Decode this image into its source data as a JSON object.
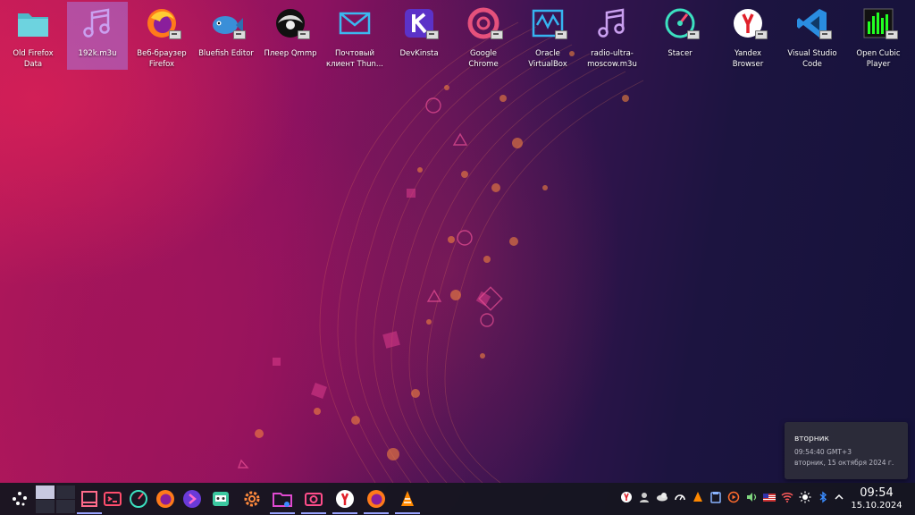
{
  "desktop": {
    "icons": [
      {
        "label": "Old Firefox\nData",
        "icon": "folder-icon"
      },
      {
        "label": "192k.m3u",
        "icon": "music-file-icon",
        "selected": true
      },
      {
        "label": "Веб-браузер\nFirefox",
        "icon": "firefox-icon"
      },
      {
        "label": "Bluefish Editor",
        "icon": "bluefish-icon"
      },
      {
        "label": "Плеер Qmmp",
        "icon": "qmmp-icon"
      },
      {
        "label": "Почтовый\nклиент Thun...",
        "icon": "mail-icon"
      },
      {
        "label": "DevKinsta",
        "icon": "devkinsta-icon"
      },
      {
        "label": "Google Chrome",
        "icon": "chrome-icon"
      },
      {
        "label": "Oracle\nVirtualBox",
        "icon": "virtualbox-icon"
      },
      {
        "label": "radio-ultra-\nmoscow.m3u",
        "icon": "music-file-icon"
      },
      {
        "label": "Stacer",
        "icon": "stacer-icon"
      },
      {
        "label": "Yandex Browser",
        "icon": "yandex-icon"
      },
      {
        "label": "Visual Studio\nCode",
        "icon": "vscode-icon"
      },
      {
        "label": "Open Cubic\nPlayer",
        "icon": "cubic-player-icon"
      }
    ]
  },
  "clock_popup": {
    "day": "вторник",
    "time": "09:54:40 GMT+3",
    "date": "вторник, 15 октября 2024 г."
  },
  "taskbar": {
    "items": [
      "launcher-icon",
      "pager",
      "show-desktop-icon",
      "terminal-icon",
      "stacer-icon",
      "firefox-icon",
      "kde-connect-icon",
      "game-icon",
      "settings-icon",
      "file-manager-icon",
      "screenshot-icon",
      "yandex-icon",
      "firefox-icon",
      "vlc-icon"
    ],
    "tray": [
      "yandex-icon",
      "user-icon",
      "weather-icon",
      "speedometer-icon",
      "vlc-icon",
      "clipboard-icon",
      "media-icon",
      "volume-icon",
      "flag-us-icon",
      "wifi-icon",
      "brightness-icon",
      "bluetooth-icon",
      "chevron-up-icon"
    ],
    "clock_time": "09:54",
    "clock_date": "15.10.2024"
  },
  "colors": {
    "accent": "#9aa4ff",
    "taskbar_bg": "#16161f",
    "selection": "#a878dc"
  }
}
